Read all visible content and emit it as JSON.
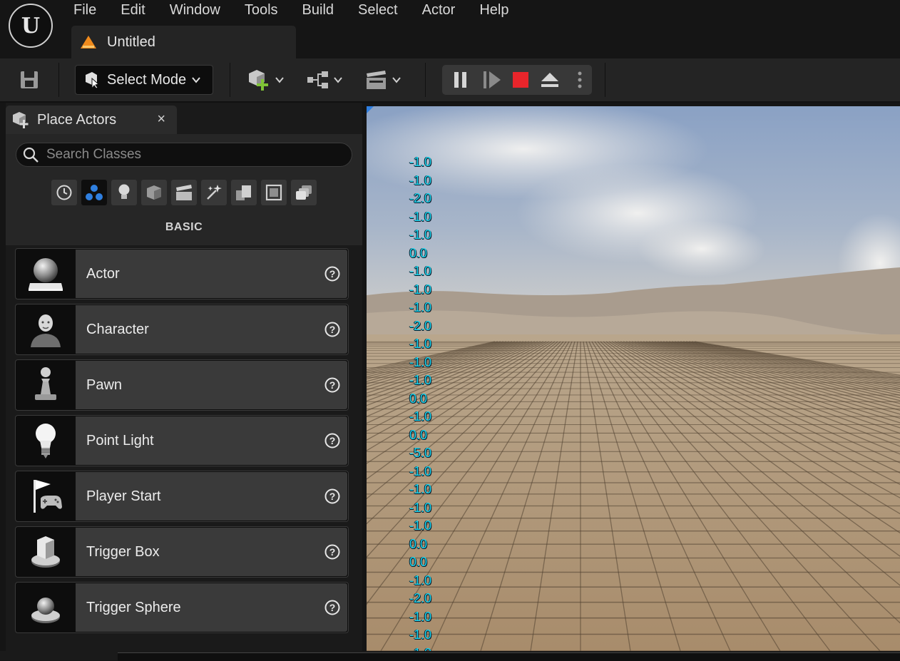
{
  "menu": [
    "File",
    "Edit",
    "Window",
    "Tools",
    "Build",
    "Select",
    "Actor",
    "Help"
  ],
  "document_tab": {
    "title": "Untitled"
  },
  "toolbar": {
    "select_mode_label": "Select Mode"
  },
  "place_actors": {
    "tab_title": "Place Actors",
    "close_glyph": "×",
    "search_placeholder": "Search Classes",
    "category_icons": [
      "recent-icon",
      "basic-shapes-icon",
      "lights-icon",
      "shapes-icon",
      "cinematic-icon",
      "visual-effects-icon",
      "geometry-icon",
      "volumes-icon",
      "all-classes-icon"
    ],
    "active_category": 1,
    "section_label": "BASIC",
    "actors": [
      {
        "name": "Actor",
        "icon": "actor-sphere-icon"
      },
      {
        "name": "Character",
        "icon": "character-icon"
      },
      {
        "name": "Pawn",
        "icon": "pawn-icon"
      },
      {
        "name": "Point Light",
        "icon": "point-light-icon"
      },
      {
        "name": "Player Start",
        "icon": "player-start-icon"
      },
      {
        "name": "Trigger Box",
        "icon": "trigger-box-icon"
      },
      {
        "name": "Trigger Sphere",
        "icon": "trigger-sphere-icon"
      }
    ]
  },
  "viewport": {
    "stat_values": [
      "-1.0",
      "-1.0",
      "-2.0",
      "-1.0",
      "-1.0",
      "0.0",
      "-1.0",
      "-1.0",
      "-1.0",
      "-2.0",
      "-1.0",
      "-1.0",
      "-1.0",
      "0.0",
      "-1.0",
      "0.0",
      "-5.0",
      "-1.0",
      "-1.0",
      "-1.0",
      "-1.0",
      "0.0",
      "0.0",
      "-1.0",
      "-2.0",
      "-1.0",
      "-1.0",
      "-1.0"
    ],
    "stat_color": "#1ad6ef"
  },
  "colors": {
    "stop_red": "#e8252b",
    "accent_blue": "#2f7fe0",
    "add_green": "#7fc436",
    "warning_orange": "#f08a1c"
  }
}
